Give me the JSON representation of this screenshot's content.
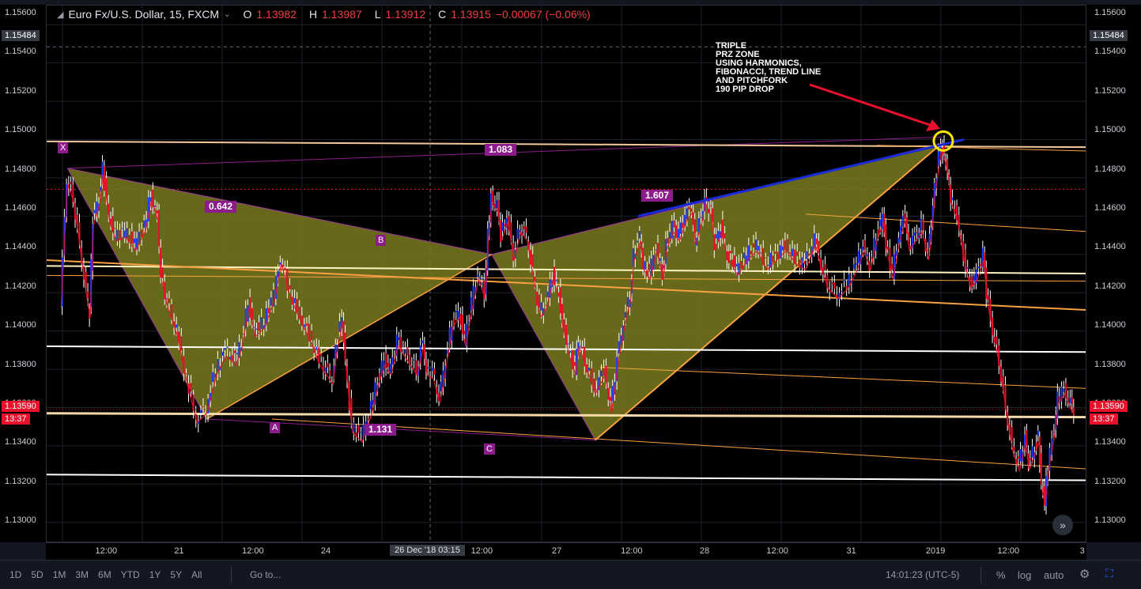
{
  "header": {
    "symbol": "Euro Fx/U.S. Dollar, 15, FXCM",
    "o_label": "O",
    "o_val": "1.13982",
    "h_label": "H",
    "h_val": "1.13987",
    "l_label": "L",
    "l_val": "1.13912",
    "c_label": "C",
    "c_val": "1.13915",
    "change": "−0.00067 (−0.06%)"
  },
  "y_axis": {
    "ticks": [
      "1.15600",
      "1.15400",
      "1.15200",
      "1.15000",
      "1.14800",
      "1.14600",
      "1.14400",
      "1.14200",
      "1.14000",
      "1.13800",
      "1.13600",
      "1.13400",
      "1.13200",
      "1.13000"
    ],
    "crosshair_price": "1.15484",
    "last_price": "1.13590",
    "countdown": "13:37"
  },
  "x_axis": {
    "ticks": [
      {
        "label": "12:00",
        "t": 0.058
      },
      {
        "label": "21",
        "t": 0.128
      },
      {
        "label": "12:00",
        "t": 0.199
      },
      {
        "label": "24",
        "t": 0.269
      },
      {
        "label": "12:00",
        "t": 0.419
      },
      {
        "label": "27",
        "t": 0.491
      },
      {
        "label": "12:00",
        "t": 0.563
      },
      {
        "label": "28",
        "t": 0.633
      },
      {
        "label": "12:00",
        "t": 0.703
      },
      {
        "label": "31",
        "t": 0.774
      },
      {
        "label": "2019",
        "t": 0.855
      },
      {
        "label": "12:00",
        "t": 0.925
      },
      {
        "label": "3",
        "t": 0.996
      }
    ],
    "crosshair_label": "26 Dec '18   03:15"
  },
  "pattern": {
    "points": {
      "X": "X",
      "A": "A",
      "B": "B",
      "C": "C"
    },
    "ratios": {
      "xb": "0.642",
      "xc": "1.083",
      "ac": "1.131",
      "bd": "1.607"
    },
    "annotation": "TRIPLE\nPRZ ZONE\nUSING HARMONICS,\nFIBONACCI, TREND LINE\nAND PITCHFORK\n190 PIP DROP"
  },
  "bottom_bar": {
    "ranges": [
      "1D",
      "5D",
      "1M",
      "3M",
      "6M",
      "YTD",
      "1Y",
      "5Y",
      "All"
    ],
    "goto": "Go to...",
    "clock": "14:01:23 (UTC-5)",
    "percent": "%",
    "log": "log",
    "auto": "auto"
  },
  "colors": {
    "background": "#000000",
    "up": "#1f3bff",
    "down": "#e8102a",
    "pattern_fill": "#7a7a1e",
    "fib_line": "#f7a142",
    "support_line": "#ffffff",
    "trend_line": "#1a2bd8",
    "arrow": "#e8102a",
    "highlight": "#ffe600",
    "badge": "#8c1c8c"
  },
  "chart_data": {
    "type": "candlestick",
    "symbol": "EURUSD",
    "timeframe": "15",
    "ylim": [
      1.129,
      1.157
    ],
    "path": [
      [
        "2018-12-20 03:00",
        1.1415
      ],
      [
        "2018-12-20 05:00",
        1.148
      ],
      [
        "2018-12-20 07:00",
        1.147
      ],
      [
        "2018-12-20 09:00",
        1.1445
      ],
      [
        "2018-12-20 11:00",
        1.142
      ],
      [
        "2018-12-20 12:00",
        1.141
      ],
      [
        "2018-12-20 13:00",
        1.1458
      ],
      [
        "2018-12-20 15:00",
        1.147
      ],
      [
        "2018-12-20 16:00",
        1.1485
      ],
      [
        "2018-12-20 18:00",
        1.146
      ],
      [
        "2018-12-20 20:00",
        1.145
      ],
      [
        "2018-12-20 23:00",
        1.1452
      ],
      [
        "2018-12-21 02:00",
        1.1445
      ],
      [
        "2018-12-21 05:00",
        1.1455
      ],
      [
        "2018-12-21 07:00",
        1.1472
      ],
      [
        "2018-12-21 09:00",
        1.146
      ],
      [
        "2018-12-21 10:00",
        1.143
      ],
      [
        "2018-12-21 12:00",
        1.1415
      ],
      [
        "2018-12-21 15:00",
        1.14
      ],
      [
        "2018-12-21 18:00",
        1.1375
      ],
      [
        "2018-12-21 21:00",
        1.1355
      ],
      [
        "2018-12-22 00:00",
        1.136
      ],
      [
        "2018-12-22 03:00",
        1.138
      ],
      [
        "2018-12-22 06:00",
        1.139
      ],
      [
        "2018-12-22 09:00",
        1.1385
      ],
      [
        "2018-12-22 11:00",
        1.1395
      ],
      [
        "2018-12-22 13:00",
        1.1415
      ],
      [
        "2018-12-22 15:00",
        1.14
      ],
      [
        "2018-12-22 18:00",
        1.1405
      ],
      [
        "2018-12-22 21:00",
        1.142
      ],
      [
        "2018-12-22 23:00",
        1.1438
      ],
      [
        "2018-12-23 02:00",
        1.142
      ],
      [
        "2018-12-23 05:00",
        1.1408
      ],
      [
        "2018-12-23 08:00",
        1.1398
      ],
      [
        "2018-12-23 11:00",
        1.1385
      ],
      [
        "2018-12-23 13:00",
        1.138
      ],
      [
        "2018-12-23 15:00",
        1.1375
      ],
      [
        "2018-12-23 16:00",
        1.139
      ],
      [
        "2018-12-23 18:00",
        1.1408
      ],
      [
        "2018-12-23 19:00",
        1.1385
      ],
      [
        "2018-12-23 21:00",
        1.135
      ],
      [
        "2018-12-24 00:00",
        1.1345
      ],
      [
        "2018-12-24 03:00",
        1.136
      ],
      [
        "2018-12-24 05:00",
        1.1375
      ],
      [
        "2018-12-24 07:00",
        1.1385
      ],
      [
        "2018-12-24 09:00",
        1.138
      ],
      [
        "2018-12-24 11:00",
        1.1395
      ],
      [
        "2018-12-24 13:00",
        1.139
      ],
      [
        "2018-12-24 15:00",
        1.1385
      ],
      [
        "2018-12-24 17:00",
        1.138
      ],
      [
        "2018-12-24 19:00",
        1.1395
      ],
      [
        "2018-12-24 20:00",
        1.138
      ],
      [
        "2018-12-24 22:00",
        1.1378
      ],
      [
        "2018-12-25 00:00",
        1.1365
      ],
      [
        "2018-12-25 02:00",
        1.1385
      ],
      [
        "2018-12-25 04:00",
        1.1405
      ],
      [
        "2018-12-25 06:00",
        1.141
      ],
      [
        "2018-12-25 08:00",
        1.1395
      ],
      [
        "2018-12-25 10:00",
        1.1415
      ],
      [
        "2018-12-25 12:00",
        1.143
      ],
      [
        "2018-12-25 14:00",
        1.142
      ],
      [
        "2018-12-25 15:00",
        1.145
      ],
      [
        "2018-12-25 16:00",
        1.147
      ],
      [
        "2018-12-25 18:00",
        1.1465
      ],
      [
        "2018-12-25 19:00",
        1.145
      ],
      [
        "2018-12-25 21:00",
        1.146
      ],
      [
        "2018-12-25 23:00",
        1.144
      ],
      [
        "2018-12-26 01:00",
        1.1455
      ],
      [
        "2018-12-26 03:00",
        1.145
      ],
      [
        "2018-12-26 05:00",
        1.143
      ],
      [
        "2018-12-26 07:00",
        1.141
      ],
      [
        "2018-12-26 09:00",
        1.1415
      ],
      [
        "2018-12-26 11:00",
        1.143
      ],
      [
        "2018-12-26 13:00",
        1.142
      ],
      [
        "2018-12-26 14:00",
        1.1405
      ],
      [
        "2018-12-26 16:00",
        1.139
      ],
      [
        "2018-12-26 18:00",
        1.138
      ],
      [
        "2018-12-26 19:00",
        1.1395
      ],
      [
        "2018-12-26 21:00",
        1.1385
      ],
      [
        "2018-12-27 00:00",
        1.137
      ],
      [
        "2018-12-27 03:00",
        1.138
      ],
      [
        "2018-12-27 05:00",
        1.136
      ],
      [
        "2018-12-27 07:00",
        1.1385
      ],
      [
        "2018-12-27 09:00",
        1.1405
      ],
      [
        "2018-12-27 11:00",
        1.142
      ],
      [
        "2018-12-27 12:00",
        1.144
      ],
      [
        "2018-12-27 14:00",
        1.145
      ],
      [
        "2018-12-27 15:00",
        1.1435
      ],
      [
        "2018-12-27 17:00",
        1.143
      ],
      [
        "2018-12-27 19:00",
        1.1445
      ],
      [
        "2018-12-27 21:00",
        1.143
      ],
      [
        "2018-12-27 22:00",
        1.1445
      ],
      [
        "2018-12-28 00:00",
        1.1455
      ],
      [
        "2018-12-28 02:00",
        1.145
      ],
      [
        "2018-12-28 04:00",
        1.146
      ],
      [
        "2018-12-28 06:00",
        1.1465
      ],
      [
        "2018-12-28 07:00",
        1.1448
      ],
      [
        "2018-12-28 09:00",
        1.146
      ],
      [
        "2018-12-28 10:00",
        1.147
      ],
      [
        "2018-12-28 12:00",
        1.1462
      ],
      [
        "2018-12-28 13:00",
        1.1445
      ],
      [
        "2018-12-28 15:00",
        1.1455
      ],
      [
        "2018-12-28 17:00",
        1.144
      ],
      [
        "2018-12-28 18:00",
        1.1438
      ],
      [
        "2018-12-28 20:00",
        1.1432
      ],
      [
        "2018-12-28 23:00",
        1.144
      ],
      [
        "2018-12-29 02:00",
        1.1445
      ],
      [
        "2018-12-29 05:00",
        1.1435
      ],
      [
        "2018-12-29 08:00",
        1.144
      ],
      [
        "2018-12-29 11:00",
        1.1445
      ],
      [
        "2018-12-29 14:00",
        1.1438
      ],
      [
        "2018-12-29 17:00",
        1.1435
      ],
      [
        "2018-12-29 20:00",
        1.1448
      ],
      [
        "2018-12-29 22:00",
        1.1435
      ],
      [
        "2018-12-30 00:00",
        1.1425
      ],
      [
        "2018-12-30 03:00",
        1.142
      ],
      [
        "2018-12-30 06:00",
        1.1425
      ],
      [
        "2018-12-30 09:00",
        1.1435
      ],
      [
        "2018-12-30 11:00",
        1.1445
      ],
      [
        "2018-12-30 13:00",
        1.1435
      ],
      [
        "2018-12-30 15:00",
        1.145
      ],
      [
        "2018-12-30 17:00",
        1.146
      ],
      [
        "2018-12-30 18:00",
        1.1445
      ],
      [
        "2018-12-30 20:00",
        1.143
      ],
      [
        "2018-12-30 22:00",
        1.145
      ],
      [
        "2018-12-31 00:00",
        1.1462
      ],
      [
        "2018-12-31 01:00",
        1.1445
      ],
      [
        "2018-12-31 03:00",
        1.145
      ],
      [
        "2018-12-31 05:00",
        1.1455
      ],
      [
        "2018-12-31 07:00",
        1.144
      ],
      [
        "2018-12-31 08:00",
        1.1455
      ],
      [
        "2018-12-31 09:00",
        1.1475
      ],
      [
        "2018-12-31 11:00",
        1.1498
      ],
      [
        "2018-12-31 12:00",
        1.1492
      ],
      [
        "2018-12-31 13:00",
        1.1485
      ],
      [
        "2018-12-31 14:00",
        1.147
      ],
      [
        "2018-12-31 16:00",
        1.146
      ],
      [
        "2018-12-31 18:00",
        1.144
      ],
      [
        "2018-12-31 20:00",
        1.1425
      ],
      [
        "2018-12-31 22:00",
        1.143
      ],
      [
        "2019-01-01 00:00",
        1.144
      ],
      [
        "2019-01-01 01:00",
        1.142
      ],
      [
        "2019-01-01 03:00",
        1.14
      ],
      [
        "2019-01-01 05:00",
        1.1385
      ],
      [
        "2019-01-01 07:00",
        1.136
      ],
      [
        "2019-01-01 09:00",
        1.134
      ],
      [
        "2019-01-01 11:00",
        1.133
      ],
      [
        "2019-01-01 13:00",
        1.1345
      ],
      [
        "2019-01-01 14:00",
        1.133
      ],
      [
        "2019-01-01 16:00",
        1.134
      ],
      [
        "2019-01-01 17:00",
        1.1345
      ],
      [
        "2019-01-01 18:00",
        1.132
      ],
      [
        "2019-01-01 19:00",
        1.1312
      ],
      [
        "2019-01-01 20:00",
        1.133
      ],
      [
        "2019-01-01 22:00",
        1.135
      ],
      [
        "2019-01-01 23:00",
        1.1365
      ],
      [
        "2019-01-02 01:00",
        1.137
      ],
      [
        "2019-01-02 03:00",
        1.1362
      ],
      [
        "2019-01-02 04:00",
        1.1359
      ]
    ],
    "last": 1.1359
  }
}
